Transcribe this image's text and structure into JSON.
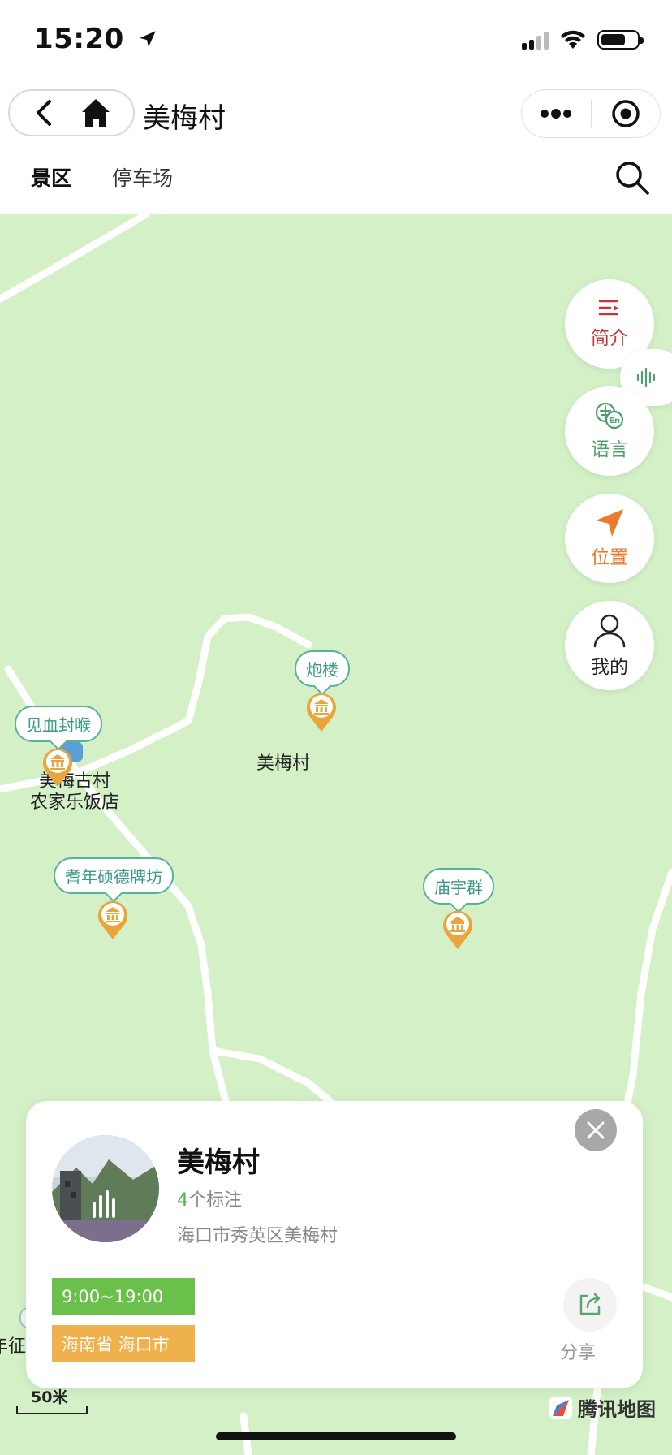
{
  "status_bar": {
    "time": "15:20"
  },
  "nav": {
    "title": "美梅村"
  },
  "tabs": [
    {
      "label": "景区"
    },
    {
      "label": "停车场"
    }
  ],
  "side_buttons": {
    "intro": "简介",
    "language": "语言",
    "location": "位置",
    "mine": "我的"
  },
  "map": {
    "callouts": {
      "paolou": "炮楼",
      "jianxue": "见血封喉",
      "qinian": "耆年硕德牌坊",
      "miaoyu": "庙宇群"
    },
    "place_labels": {
      "village": "美梅村",
      "restaurant_line1": "美梅古村",
      "restaurant_line2": "农家乐饭店",
      "edge_fragment": "年征"
    },
    "scale": "50米",
    "logo": "腾讯地图"
  },
  "card": {
    "title": "美梅村",
    "marker_count": "4",
    "marker_suffix": "个标注",
    "address": "海口市秀英区美梅村",
    "hours": "9:00~19:00",
    "region": "海南省 海口市",
    "share": "分享"
  },
  "colors": {
    "map_bg": "#d3f0c6",
    "callout_border": "#56b39b",
    "pin": "#e9a53a",
    "intro_red": "#c8353a",
    "lang_green": "#4f9e6e",
    "location_orange": "#e87c2c",
    "tag_green": "#6ac04a",
    "tag_orange": "#efb14b"
  }
}
